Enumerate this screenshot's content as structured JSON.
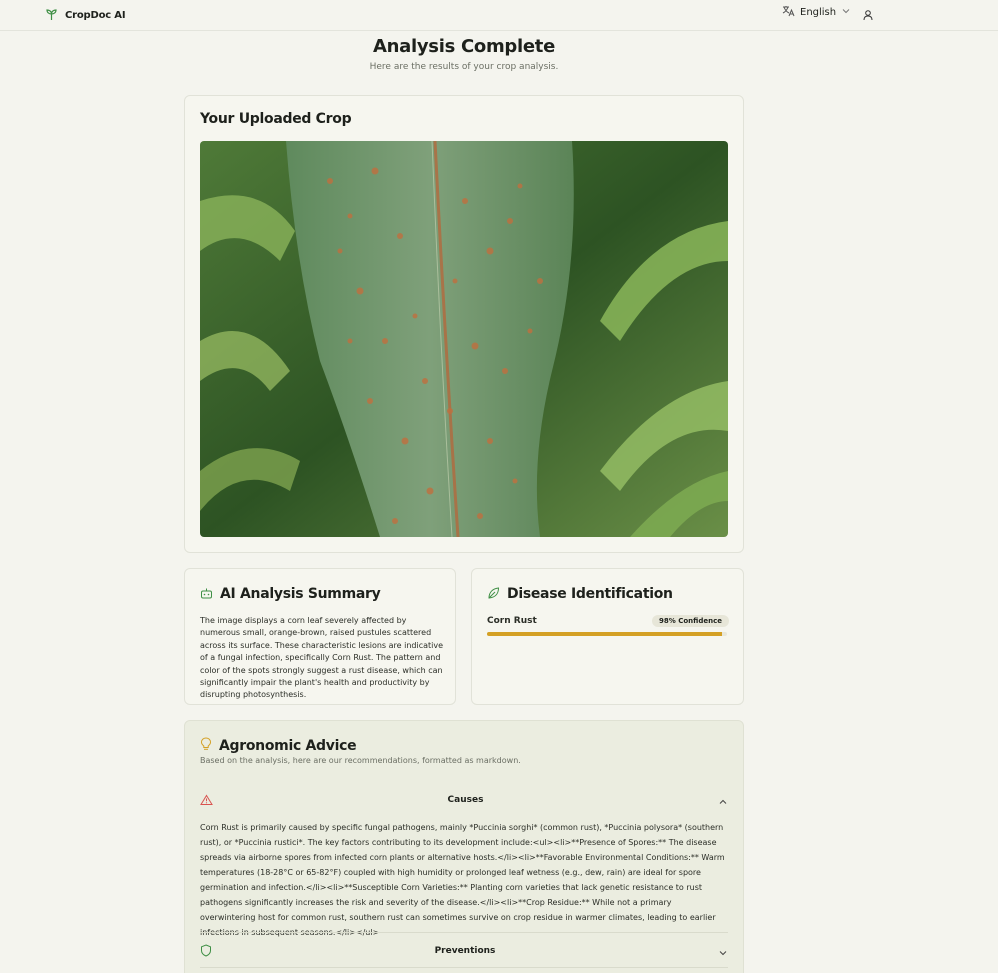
{
  "app": {
    "name": "CropDoc AI"
  },
  "header": {
    "language": "English"
  },
  "page": {
    "title": "Analysis Complete",
    "subtitle": "Here are the results of your crop analysis."
  },
  "upload": {
    "title": "Your Uploaded Crop"
  },
  "summary": {
    "title": "AI Analysis Summary",
    "text": "The image displays a corn leaf severely affected by numerous small, orange-brown, raised pustules scattered across its surface. These characteristic lesions are indicative of a fungal infection, specifically Corn Rust. The pattern and color of the spots strongly suggest a rust disease, which can significantly impair the plant's health and productivity by disrupting photosynthesis."
  },
  "disease": {
    "title": "Disease Identification",
    "name": "Corn Rust",
    "confidence_label": "98% Confidence",
    "confidence": 0.98
  },
  "advice": {
    "title": "Agronomic Advice",
    "subtitle": "Based on the analysis, here are our recommendations, formatted as markdown.",
    "causes_label": "Causes",
    "causes_text": "Corn Rust is primarily caused by specific fungal pathogens, mainly *Puccinia sorghi* (common rust), *Puccinia polysora* (southern rust), or *Puccinia rustici*. The key factors contributing to its development include:<ul><li>**Presence of Spores:** The disease spreads via airborne spores from infected corn plants or alternative hosts.</li><li>**Favorable Environmental Conditions:** Warm temperatures (18-28°C or 65-82°F) coupled with high humidity or prolonged leaf wetness (e.g., dew, rain) are ideal for spore germination and infection.</li><li>**Susceptible Corn Varieties:** Planting corn varieties that lack genetic resistance to rust pathogens significantly increases the risk and severity of the disease.</li><li>**Crop Residue:** While not a primary overwintering host for common rust, southern rust can sometimes survive on crop residue in warmer climates, leading to earlier infections in subsequent seasons.</li></ul>",
    "preventions_label": "Preventions"
  },
  "colors": {
    "accent_green": "#3f8f45",
    "confidence_bar": "#d4a024",
    "warning_red": "#d9534f",
    "bulb_amber": "#d4a024"
  },
  "icons": {
    "brand": "sprout-icon",
    "language": "translate-icon",
    "user": "user-icon",
    "summary": "bot-icon",
    "disease": "leaf-icon",
    "advice": "lightbulb-icon",
    "causes": "alert-triangle-icon",
    "preventions": "shield-icon"
  }
}
